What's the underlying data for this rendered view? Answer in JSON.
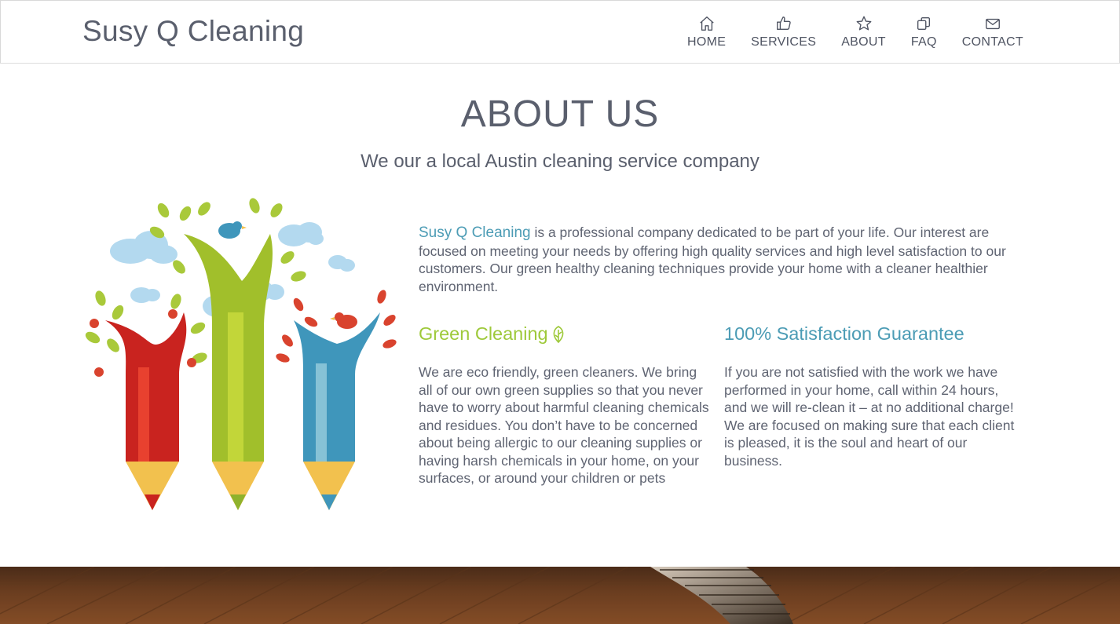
{
  "header": {
    "brand": "Susy Q Cleaning",
    "nav": [
      {
        "label": "HOME",
        "icon": "home-icon"
      },
      {
        "label": "SERVICES",
        "icon": "thumbs-up-icon"
      },
      {
        "label": "ABOUT",
        "icon": "star-icon"
      },
      {
        "label": "FAQ",
        "icon": "copy-icon"
      },
      {
        "label": "CONTACT",
        "icon": "envelope-icon"
      }
    ]
  },
  "about": {
    "title": "ABOUT US",
    "subtitle": "We our a local Austin cleaning service company",
    "intro_brand": "Susy Q Cleaning",
    "intro_text": " is a professional company dedicated to be part of your life. Our interest are focused on meeting your needs by offering high quality services and high level satisfaction to our customers. Our green healthy cleaning techniques provide your home with a cleaner healthier environment."
  },
  "green": {
    "heading": "Green Cleaning",
    "icon": "leaf-icon",
    "text": "We are eco friendly, green cleaners. We bring all of our own green supplies so that you never have to worry about harmful cleaning chemicals and residues. You don’t have to be concerned about being allergic to our cleaning supplies or having harsh chemicals in your home, on your surfaces, or around your children or pets"
  },
  "guarantee": {
    "heading": "100% Satisfaction Guarantee",
    "text": "If you are not satisfied with the work we have performed in your home, call within 24 hours, and we will re-clean it – at no additional charge! We are focused on making sure that each client is pleased, it is the soul and heart of our business."
  },
  "colors": {
    "accent_blue": "#4c9cb5",
    "accent_green": "#9ec93a",
    "text": "#5f6472"
  }
}
